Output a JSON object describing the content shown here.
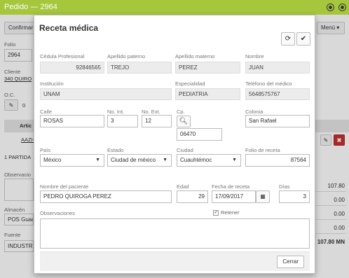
{
  "window": {
    "title": "Pedido — 2964"
  },
  "background": {
    "confirm_label": "Confirmar",
    "menu_label": "Menú",
    "folio_label": "Folio",
    "folio_value": "2964",
    "cliente_label": "Cliente",
    "cliente_value": "340 QUIRO",
    "oc_label": "O.C.",
    "oc_value": "0",
    "articulo_header": "Artic",
    "articulo_row": "AAZI-",
    "partidas_text": "1 PARTIDA",
    "observaciones_label": "Observacio",
    "almacen_label": "Almacén",
    "almacen_value": "POS Guac",
    "fuente_label": "Fuente",
    "fuente_value": "INDUSTR",
    "totals": [
      "107.80",
      "0.00",
      "0.00",
      "0.00",
      "107.80 MN"
    ]
  },
  "modal": {
    "title": "Receta médica",
    "fields": {
      "cedula": {
        "label": "Cédula Profesional",
        "value": "92846565"
      },
      "apellido_paterno": {
        "label": "Apellido paterno",
        "value": "TREJO"
      },
      "apellido_materno": {
        "label": "Apellido materno",
        "value": "PEREZ"
      },
      "nombre": {
        "label": "Nombre",
        "value": "JUAN"
      },
      "institucion": {
        "label": "Institución",
        "value": "UNAM"
      },
      "especialidad": {
        "label": "Especialidad",
        "value": "PEDIATRIA"
      },
      "telefono": {
        "label": "Teléfono del médico",
        "value": "5648575767"
      },
      "calle": {
        "label": "Calle",
        "value": "ROSAS"
      },
      "no_int": {
        "label": "No. Int.",
        "value": "3"
      },
      "no_ext": {
        "label": "No. Ext.",
        "value": "12"
      },
      "cp": {
        "label": "Cp.",
        "value": "06470"
      },
      "colonia": {
        "label": "Colonia",
        "value": "San Rafael"
      },
      "pais": {
        "label": "País",
        "value": "México"
      },
      "estado": {
        "label": "Estado",
        "value": "Ciudad de méxico"
      },
      "ciudad": {
        "label": "Ciudad",
        "value": "Cuauhtémoc"
      },
      "folio_receta": {
        "label": "Folio de receta",
        "value": "87564"
      },
      "paciente": {
        "label": "Nombre del paciente",
        "value": "PEDRO QUIROGA PEREZ"
      },
      "edad": {
        "label": "Edad",
        "value": "29"
      },
      "fecha": {
        "label": "Fecha de receta",
        "value": "17/09/2017"
      },
      "dias": {
        "label": "Días",
        "value": "3"
      },
      "observaciones": {
        "label": "Observaciones",
        "value": ""
      },
      "retener": {
        "label": "Retener",
        "checked": true
      }
    },
    "close_label": "Cerrar"
  }
}
